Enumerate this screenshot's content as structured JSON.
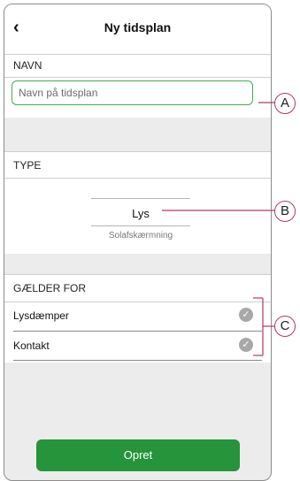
{
  "header": {
    "back_icon": "chevron-left-icon",
    "title": "Ny tidsplan"
  },
  "name_section": {
    "label": "NAVN",
    "placeholder": "Navn på tidsplan"
  },
  "type_section": {
    "label": "TYPE",
    "picker": {
      "selected": "Lys",
      "next": "Solafskærmning"
    }
  },
  "applies_section": {
    "label": "GÆLDER FOR",
    "items": [
      {
        "label": "Lysdæmper",
        "checked": true
      },
      {
        "label": "Kontakt",
        "checked": true
      }
    ]
  },
  "button": {
    "label": "Opret"
  },
  "callouts": [
    "A",
    "B",
    "C"
  ],
  "colors": {
    "accent_green": "#25943a",
    "input_border": "#3db14c",
    "callout_line": "#b33a5a"
  }
}
